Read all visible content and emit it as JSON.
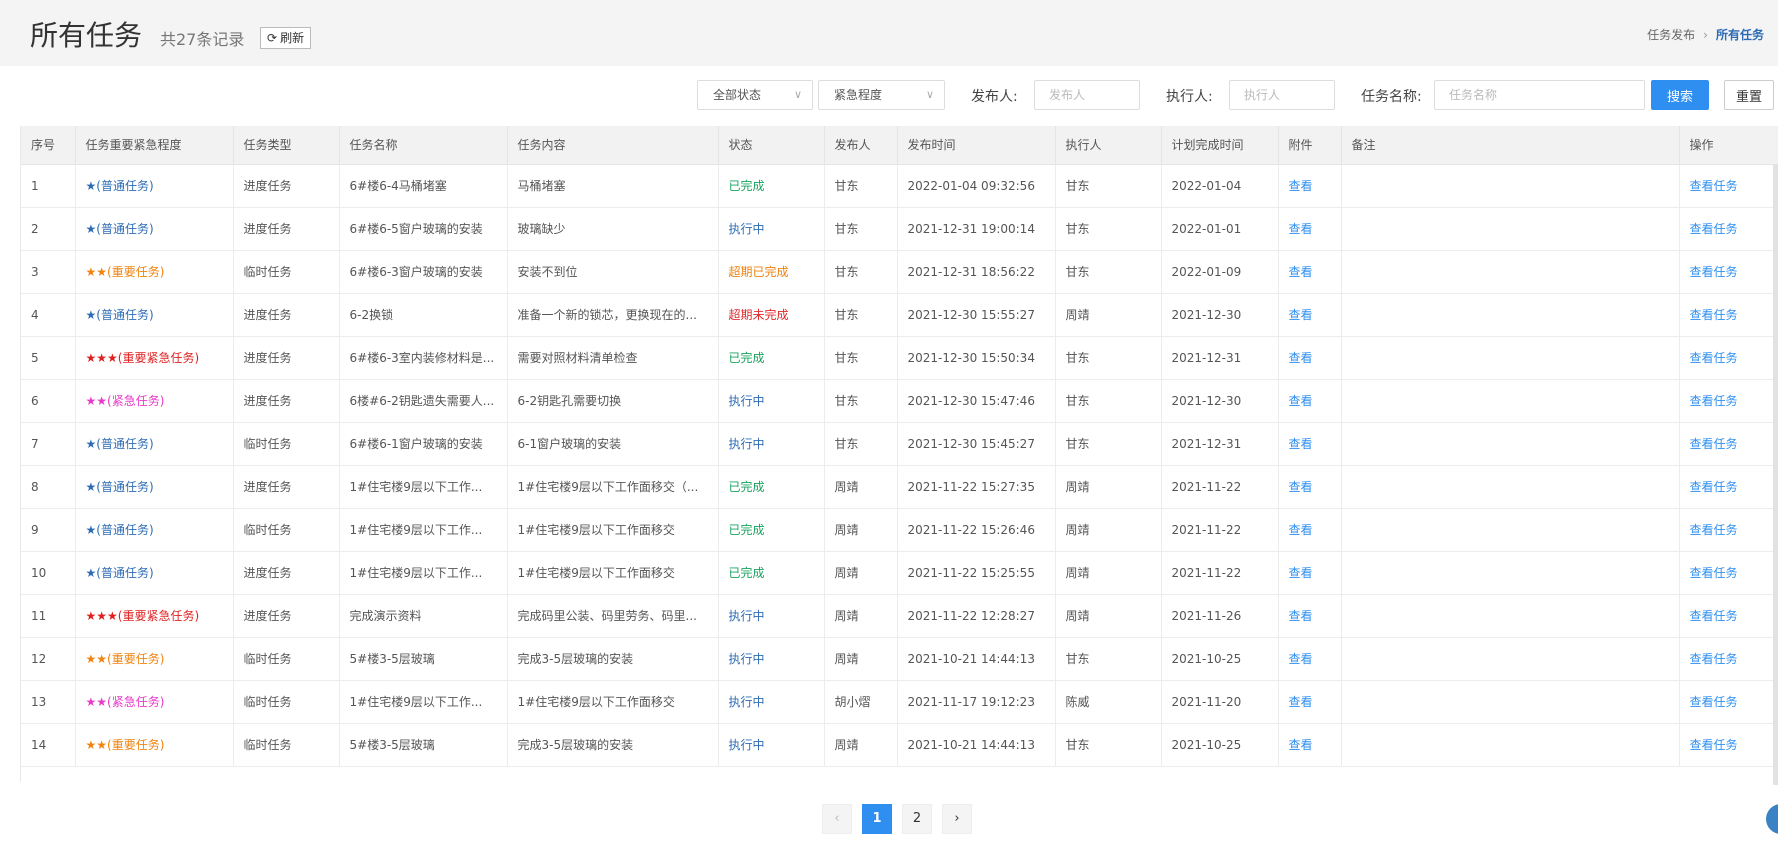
{
  "header": {
    "title": "所有任务",
    "record_count": "共27条记录",
    "refresh_label": "刷新",
    "breadcrumb": [
      "任务发布",
      "所有任务"
    ],
    "breadcrumb_sep": "›"
  },
  "filters": {
    "status_select": "全部状态",
    "urgency_select": "紧急程度",
    "publisher_label": "发布人:",
    "publisher_placeholder": "发布人",
    "executor_label": "执行人:",
    "executor_placeholder": "执行人",
    "task_name_label": "任务名称:",
    "task_name_placeholder": "任务名称",
    "search_label": "搜索",
    "reset_label": "重置"
  },
  "table": {
    "columns": [
      "序号",
      "任务重要紧急程度",
      "任务类型",
      "任务名称",
      "任务内容",
      "状态",
      "发布人",
      "发布时间",
      "执行人",
      "计划完成时间",
      "附件",
      "备注",
      "操作"
    ],
    "rows": [
      {
        "no": "1",
        "priority": "★(普通任务)",
        "ptype": "normal",
        "type": "进度任务",
        "name": "6#楼6-4马桶堵塞",
        "content": "马桶堵塞",
        "status": "已完成",
        "stype": "done",
        "publisher": "甘东",
        "pub_time": "2022-01-04 09:32:56",
        "executor": "甘东",
        "due": "2022-01-04",
        "attach": "查看",
        "remark": "",
        "action": "查看任务"
      },
      {
        "no": "2",
        "priority": "★(普通任务)",
        "ptype": "normal",
        "type": "进度任务",
        "name": "6#楼6-5窗户玻璃的安装",
        "content": "玻璃缺少",
        "status": "执行中",
        "stype": "running",
        "publisher": "甘东",
        "pub_time": "2021-12-31 19:00:14",
        "executor": "甘东",
        "due": "2022-01-01",
        "attach": "查看",
        "remark": "",
        "action": "查看任务"
      },
      {
        "no": "3",
        "priority": "★★(重要任务)",
        "ptype": "important",
        "type": "临时任务",
        "name": "6#楼6-3窗户玻璃的安装",
        "content": "安装不到位",
        "status": "超期已完成",
        "stype": "overdone",
        "publisher": "甘东",
        "pub_time": "2021-12-31 18:56:22",
        "executor": "甘东",
        "due": "2022-01-09",
        "attach": "查看",
        "remark": "",
        "action": "查看任务"
      },
      {
        "no": "4",
        "priority": "★(普通任务)",
        "ptype": "normal",
        "type": "进度任务",
        "name": "6-2换锁",
        "content": "准备一个新的锁芯，更换现在的...",
        "status": "超期未完成",
        "stype": "overundone",
        "publisher": "甘东",
        "pub_time": "2021-12-30 15:55:27",
        "executor": "周靖",
        "due": "2021-12-30",
        "attach": "查看",
        "remark": "",
        "action": "查看任务"
      },
      {
        "no": "5",
        "priority": "★★★(重要紧急任务)",
        "ptype": "critical",
        "type": "进度任务",
        "name": "6#楼6-3室内装修材料是...",
        "content": "需要对照材料清单检查",
        "status": "已完成",
        "stype": "done",
        "publisher": "甘东",
        "pub_time": "2021-12-30 15:50:34",
        "executor": "甘东",
        "due": "2021-12-31",
        "attach": "查看",
        "remark": "",
        "action": "查看任务"
      },
      {
        "no": "6",
        "priority": "★★(紧急任务)",
        "ptype": "urgent",
        "type": "进度任务",
        "name": "6楼#6-2钥匙遗失需要人...",
        "content": "6-2钥匙孔需要切换",
        "status": "执行中",
        "stype": "running",
        "publisher": "甘东",
        "pub_time": "2021-12-30 15:47:46",
        "executor": "甘东",
        "due": "2021-12-30",
        "attach": "查看",
        "remark": "",
        "action": "查看任务"
      },
      {
        "no": "7",
        "priority": "★(普通任务)",
        "ptype": "normal",
        "type": "临时任务",
        "name": "6#楼6-1窗户玻璃的安装",
        "content": "6-1窗户玻璃的安装",
        "status": "执行中",
        "stype": "running",
        "publisher": "甘东",
        "pub_time": "2021-12-30 15:45:27",
        "executor": "甘东",
        "due": "2021-12-31",
        "attach": "查看",
        "remark": "",
        "action": "查看任务"
      },
      {
        "no": "8",
        "priority": "★(普通任务)",
        "ptype": "normal",
        "type": "进度任务",
        "name": "1#住宅楼9层以下工作...",
        "content": "1#住宅楼9层以下工作面移交（...",
        "status": "已完成",
        "stype": "done",
        "publisher": "周靖",
        "pub_time": "2021-11-22 15:27:35",
        "executor": "周靖",
        "due": "2021-11-22",
        "attach": "查看",
        "remark": "",
        "action": "查看任务"
      },
      {
        "no": "9",
        "priority": "★(普通任务)",
        "ptype": "normal",
        "type": "临时任务",
        "name": "1#住宅楼9层以下工作...",
        "content": "1#住宅楼9层以下工作面移交",
        "status": "已完成",
        "stype": "done",
        "publisher": "周靖",
        "pub_time": "2021-11-22 15:26:46",
        "executor": "周靖",
        "due": "2021-11-22",
        "attach": "查看",
        "remark": "",
        "action": "查看任务"
      },
      {
        "no": "10",
        "priority": "★(普通任务)",
        "ptype": "normal",
        "type": "进度任务",
        "name": "1#住宅楼9层以下工作...",
        "content": "1#住宅楼9层以下工作面移交",
        "status": "已完成",
        "stype": "done",
        "publisher": "周靖",
        "pub_time": "2021-11-22 15:25:55",
        "executor": "周靖",
        "due": "2021-11-22",
        "attach": "查看",
        "remark": "",
        "action": "查看任务"
      },
      {
        "no": "11",
        "priority": "★★★(重要紧急任务)",
        "ptype": "critical",
        "type": "进度任务",
        "name": "完成演示资料",
        "content": "完成码里公装、码里劳务、码里...",
        "status": "执行中",
        "stype": "running",
        "publisher": "周靖",
        "pub_time": "2021-11-22 12:28:27",
        "executor": "周靖",
        "due": "2021-11-26",
        "attach": "查看",
        "remark": "",
        "action": "查看任务"
      },
      {
        "no": "12",
        "priority": "★★(重要任务)",
        "ptype": "important",
        "type": "临时任务",
        "name": "5#楼3-5层玻璃",
        "content": "完成3-5层玻璃的安装",
        "status": "执行中",
        "stype": "running",
        "publisher": "周靖",
        "pub_time": "2021-10-21 14:44:13",
        "executor": "甘东",
        "due": "2021-10-25",
        "attach": "查看",
        "remark": "",
        "action": "查看任务"
      },
      {
        "no": "13",
        "priority": "★★(紧急任务)",
        "ptype": "urgent",
        "type": "临时任务",
        "name": "1#住宅楼9层以下工作...",
        "content": "1#住宅楼9层以下工作面移交",
        "status": "执行中",
        "stype": "running",
        "publisher": "胡小熠",
        "pub_time": "2021-11-17 19:12:23",
        "executor": "陈威",
        "due": "2021-11-20",
        "attach": "查看",
        "remark": "",
        "action": "查看任务"
      },
      {
        "no": "14",
        "priority": "★★(重要任务)",
        "ptype": "important",
        "type": "临时任务",
        "name": "5#楼3-5层玻璃",
        "content": "完成3-5层玻璃的安装",
        "status": "执行中",
        "stype": "running",
        "publisher": "周靖",
        "pub_time": "2021-10-21 14:44:13",
        "executor": "甘东",
        "due": "2021-10-25",
        "attach": "查看",
        "remark": "",
        "action": "查看任务"
      }
    ]
  },
  "pagination": {
    "prev": "‹",
    "pages": [
      "1",
      "2"
    ],
    "current": "1",
    "next": "›"
  },
  "colors": {
    "accent": "#2f8ff0",
    "normal": "#2d6cb5",
    "important": "#f0830f",
    "urgent": "#e83ac8",
    "critical": "#e02020",
    "done": "#19a35f"
  }
}
